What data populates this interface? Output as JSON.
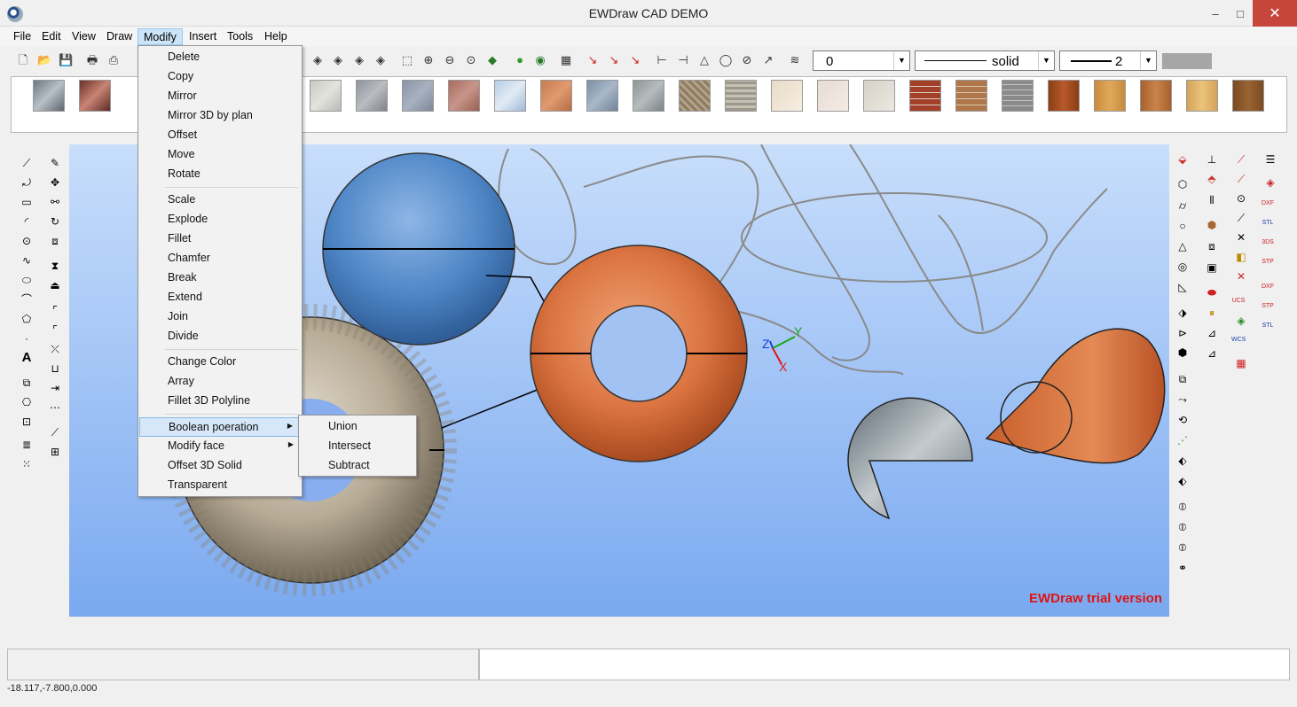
{
  "window": {
    "title": "EWDraw CAD DEMO",
    "minimize": "‒",
    "maximize": "□",
    "close": "✕"
  },
  "menubar": [
    "File",
    "Edit",
    "View",
    "Draw",
    "Modify",
    "Insert",
    "Tools",
    "Help"
  ],
  "modify_menu": {
    "items": [
      {
        "label": "Delete"
      },
      {
        "label": "Copy"
      },
      {
        "label": "Mirror"
      },
      {
        "label": "Mirror 3D by plan"
      },
      {
        "label": "Offset"
      },
      {
        "label": "Move"
      },
      {
        "label": "Rotate"
      },
      {
        "label": "Scale"
      },
      {
        "label": "Explode"
      },
      {
        "label": "Fillet"
      },
      {
        "label": "Chamfer"
      },
      {
        "label": "Break"
      },
      {
        "label": "Extend"
      },
      {
        "label": "Join"
      },
      {
        "label": "Divide"
      },
      {
        "label": "Change Color"
      },
      {
        "label": "Array"
      },
      {
        "label": "Fillet 3D Polyline"
      },
      {
        "label": "Boolean poeration",
        "submenu": true,
        "highlighted": true
      },
      {
        "label": "Modify face",
        "submenu": true
      },
      {
        "label": "Offset 3D Solid"
      },
      {
        "label": "Transparent"
      }
    ]
  },
  "boolean_submenu": [
    "Union",
    "Intersect",
    "Subtract"
  ],
  "toolbar": {
    "layer_value": "0",
    "linetype_value": "solid",
    "lineweight_value": "2"
  },
  "viewport": {
    "watermark": "EWDraw trial version",
    "axis_labels": {
      "x": "X",
      "y": "Y",
      "z": "Z"
    },
    "background_top": "#c8defb",
    "background_bottom": "#7aa9f0"
  },
  "status": {
    "coordinates": "-18.117,-7.800,0.000"
  },
  "colors": {
    "accent_menu": "#cce4f7",
    "close_button": "#c7463c",
    "watermark": "#e01313"
  }
}
